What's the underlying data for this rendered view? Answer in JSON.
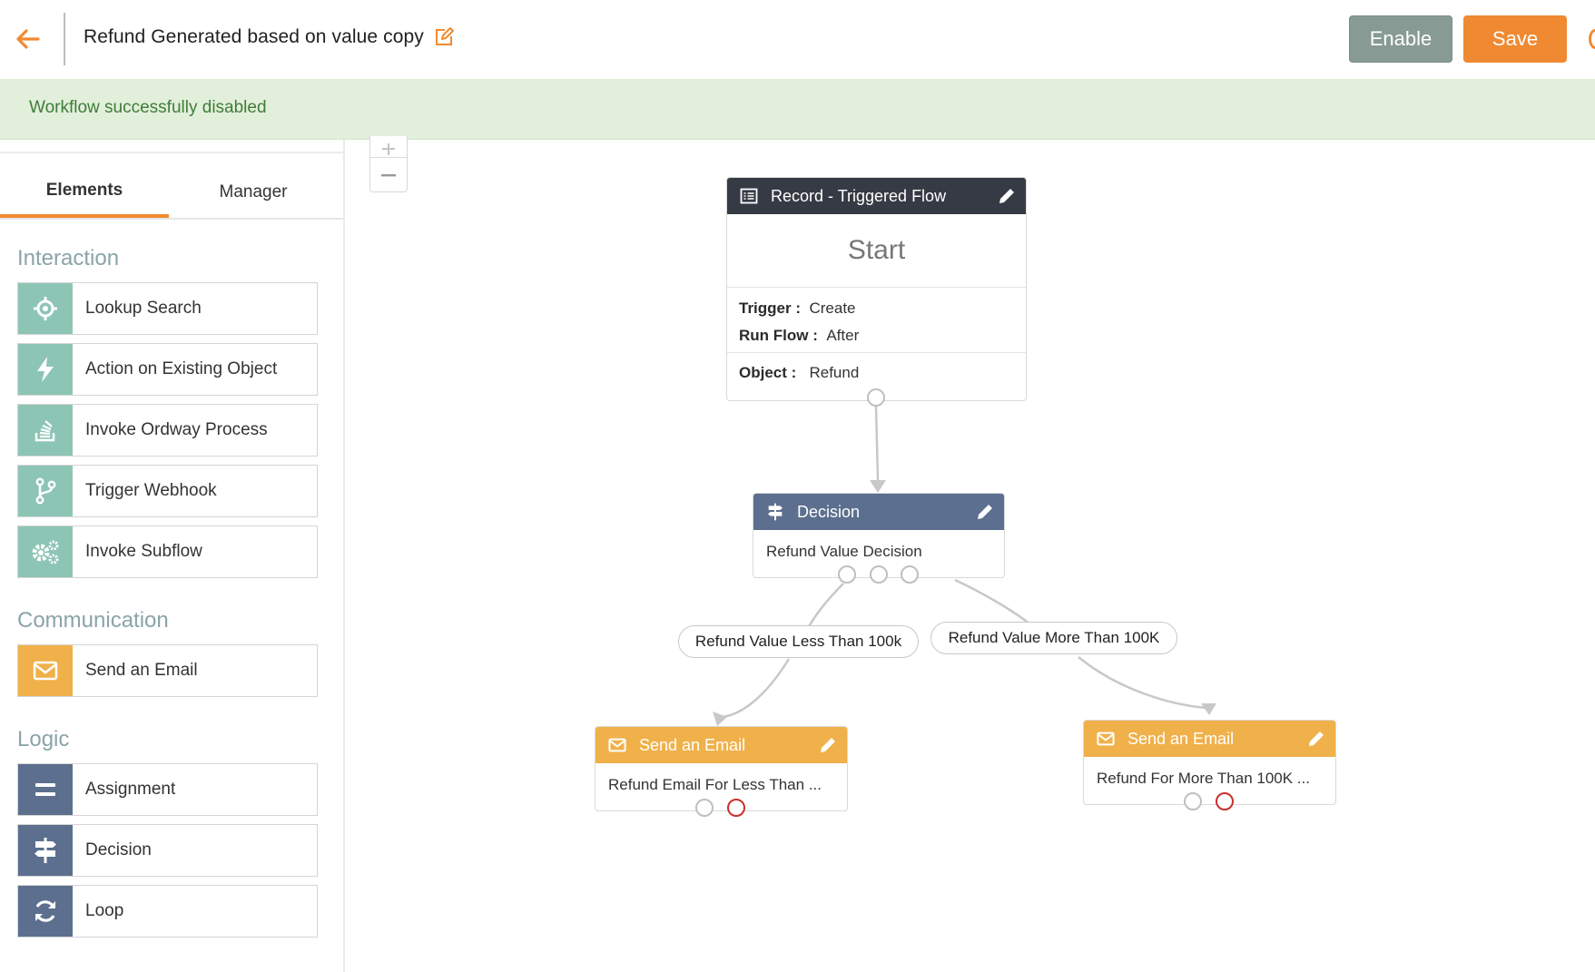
{
  "header": {
    "title": "Refund Generated based on value copy",
    "enable_label": "Enable",
    "save_label": "Save"
  },
  "banner": {
    "message": "Workflow successfully disabled"
  },
  "sidebar": {
    "tabs": [
      {
        "label": "Elements",
        "active": true
      },
      {
        "label": "Manager",
        "active": false
      }
    ],
    "sections": [
      {
        "title": "Interaction",
        "items": [
          {
            "label": "Lookup Search",
            "icon": "crosshair-icon"
          },
          {
            "label": "Action on Existing Object",
            "icon": "bolt-icon"
          },
          {
            "label": "Invoke Ordway Process",
            "icon": "stack-icon"
          },
          {
            "label": "Trigger Webhook",
            "icon": "branch-icon"
          },
          {
            "label": "Invoke Subflow",
            "icon": "gears-icon"
          }
        ]
      },
      {
        "title": "Communication",
        "items": [
          {
            "label": "Send an Email",
            "icon": "envelope-icon"
          }
        ]
      },
      {
        "title": "Logic",
        "items": [
          {
            "label": "Assignment",
            "icon": "equals-icon"
          },
          {
            "label": "Decision",
            "icon": "signpost-icon"
          },
          {
            "label": "Loop",
            "icon": "loop-icon"
          }
        ]
      }
    ]
  },
  "canvas": {
    "start_node": {
      "header": "Record - Triggered Flow",
      "title": "Start",
      "trigger_key": "Trigger :",
      "trigger_value": "Create",
      "runflow_key": "Run Flow :",
      "runflow_value": "After",
      "object_key": "Object :",
      "object_value": "Refund"
    },
    "decision_node": {
      "header": "Decision",
      "body": "Refund Value Decision"
    },
    "edge_labels": {
      "left": "Refund Value Less Than 100k",
      "right": "Refund Value More Than 100K"
    },
    "email_node_left": {
      "header": "Send an Email",
      "body": "Refund Email For Less Than ..."
    },
    "email_node_right": {
      "header": "Send an Email",
      "body": "Refund For More Than 100K ..."
    }
  },
  "colors": {
    "accent": "#f08a32",
    "enable_button": "#879b94",
    "banner_bg": "#e2efdb",
    "banner_text": "#3f7d38",
    "interaction_icon_bg": "#8dc5b5",
    "communication_icon_bg": "#f0b14a",
    "logic_icon_bg": "#5c6f8e",
    "start_header": "#363a44",
    "error_port": "#c9302c"
  }
}
